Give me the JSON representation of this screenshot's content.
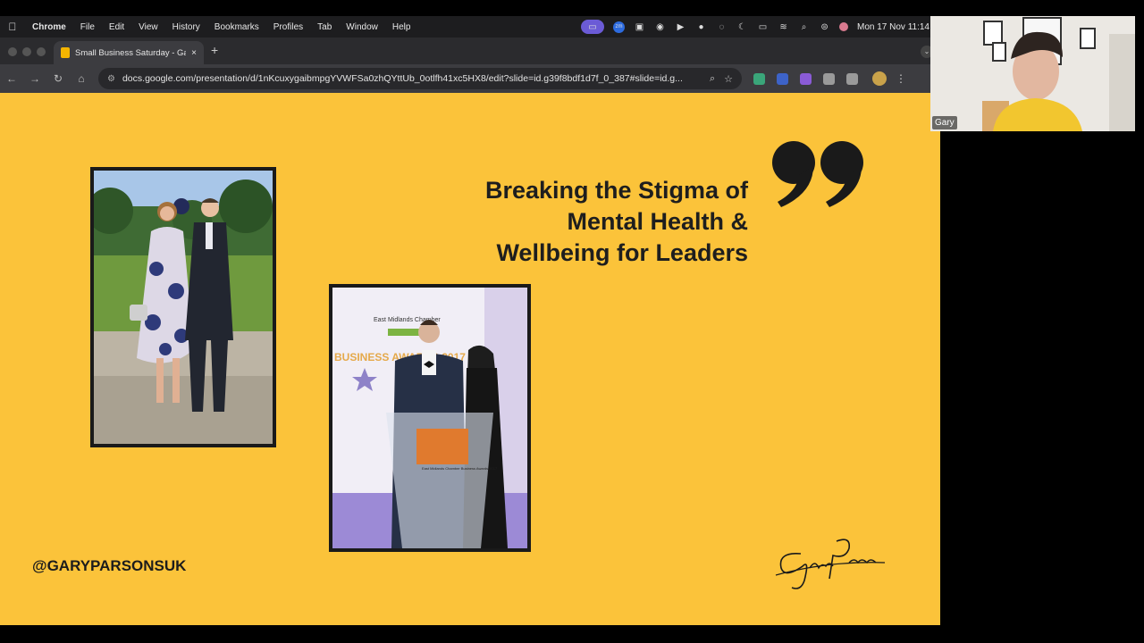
{
  "menubar": {
    "app": "Chrome",
    "menus": [
      "File",
      "Edit",
      "View",
      "History",
      "Bookmarks",
      "Profiles",
      "Tab",
      "Window",
      "Help"
    ],
    "clock": "Mon 17 Nov  11:14",
    "status_icons": [
      "screen-record-icon",
      "zoom-icon",
      "display-icon",
      "grammarly-icon",
      "play-icon",
      "circle-icon",
      "moon-arc-icon",
      "moon-icon",
      "battery-icon",
      "wifi-icon",
      "search-icon",
      "control-center-icon",
      "user-icon"
    ]
  },
  "browser": {
    "tab_title": "Small Business Saturday - Ga",
    "url": "docs.google.com/presentation/d/1nKcuxygaibmpgYVWFSa0zhQYttUb_0otlfh41xc5HX8/edit?slide=id.g39f8bdf1d7f_0_387#slide=id.g...",
    "new_tab": "+",
    "close_tab": "×",
    "extension_colors": [
      "#3aa67a",
      "#3d63c8",
      "#8a5bd6",
      "#9a9a9a",
      "#9a9a9a"
    ]
  },
  "slide": {
    "background": "#fbc33a",
    "headline": "Breaking the Stigma of Mental Health & Wellbeing for Leaders",
    "handle": "@GARYPARSONSUK",
    "signature": "Gary Parsons",
    "photo2_banner": "BUSINESS AWARDS 2017",
    "photo2_logo": "East Midlands Chamber",
    "photo2_lectern": "East Midlands Chamber Business Awards 2017"
  },
  "camera": {
    "participant_name": "Gary"
  }
}
